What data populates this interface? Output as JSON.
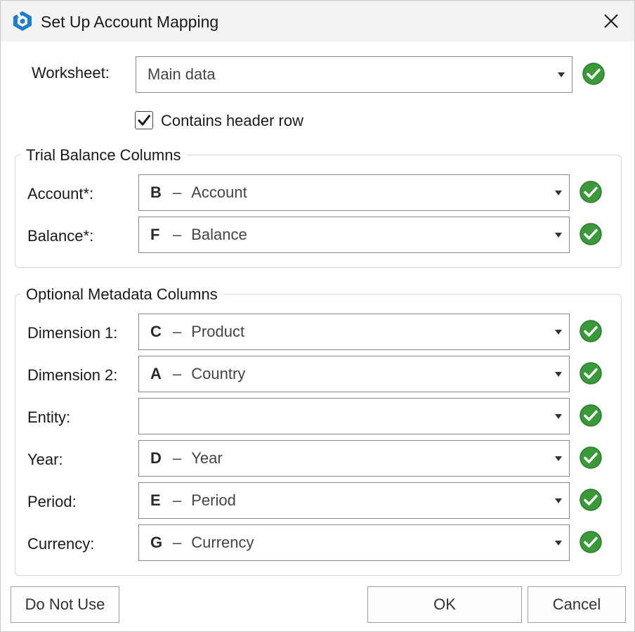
{
  "window": {
    "title": "Set Up Account Mapping"
  },
  "worksheet": {
    "label": "Worksheet:",
    "value": "Main data"
  },
  "header_row": {
    "label": "Contains header row",
    "checked": true
  },
  "trial_balance": {
    "title": "Trial Balance Columns",
    "rows": [
      {
        "label": "Account*:",
        "letter": "B",
        "dash": "–",
        "name": "Account"
      },
      {
        "label": "Balance*:",
        "letter": "F",
        "dash": "–",
        "name": "Balance"
      }
    ]
  },
  "metadata": {
    "title": "Optional Metadata Columns",
    "rows": [
      {
        "label": "Dimension 1:",
        "letter": "C",
        "dash": "–",
        "name": "Product"
      },
      {
        "label": "Dimension 2:",
        "letter": "A",
        "dash": "–",
        "name": "Country"
      },
      {
        "label": "Entity:",
        "letter": "",
        "dash": "",
        "name": ""
      },
      {
        "label": "Year:",
        "letter": "D",
        "dash": "–",
        "name": "Year"
      },
      {
        "label": "Period:",
        "letter": "E",
        "dash": "–",
        "name": "Period"
      },
      {
        "label": "Currency:",
        "letter": "G",
        "dash": "–",
        "name": "Currency"
      }
    ]
  },
  "buttons": {
    "do_not_use": "Do Not Use",
    "ok": "OK",
    "cancel": "Cancel"
  },
  "colors": {
    "status_ok": "#3a9a3a",
    "app_icon": "#1e7fcf",
    "group_border": "#cdd7e2"
  },
  "icons": {
    "app": "app-logo-icon",
    "close": "close-icon",
    "dropdown": "chevron-down-icon",
    "status": "check-circle-icon",
    "checkbox": "checkmark-icon"
  }
}
